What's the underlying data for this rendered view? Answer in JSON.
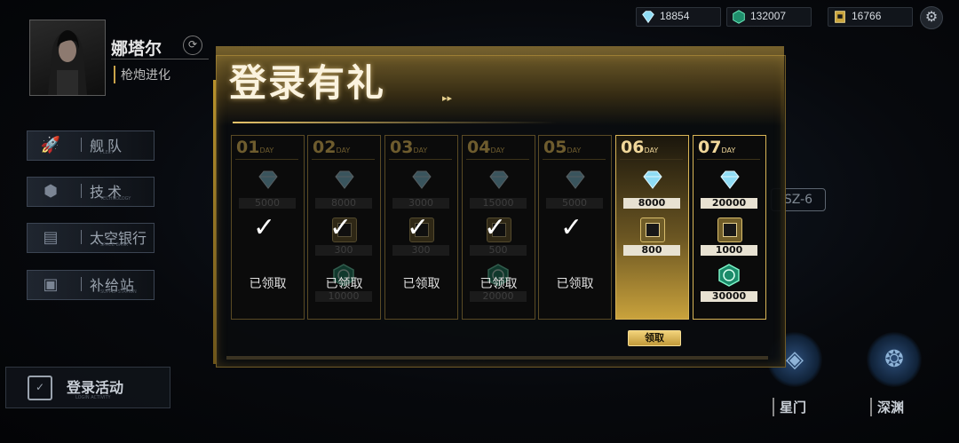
{
  "resources": [
    {
      "icon": "diamond-icon",
      "value": "18854"
    },
    {
      "icon": "energy-core-icon",
      "value": "132007"
    },
    {
      "icon": "chip-card-icon",
      "value": "16766"
    }
  ],
  "profile": {
    "name": "娜塔尔",
    "subtitle": "枪炮进化"
  },
  "menu": [
    {
      "label": "舰队",
      "sub": "FLEET"
    },
    {
      "label": "技术",
      "sub": "TECHNOLOGY"
    },
    {
      "label": "太空银行",
      "sub": "SPACE BANK"
    },
    {
      "label": "补给站",
      "sub": "SUPPLY STATION"
    }
  ],
  "login_activity": {
    "label": "登录活动",
    "sub": "LOGIN ACTIVITY"
  },
  "right_nav": {
    "stargate": "星门",
    "abyss": "深渊",
    "stage": "SZ-6"
  },
  "modal": {
    "title": "登录有礼",
    "day_suffix": "DAY",
    "claimed_text": "已领取",
    "claim_button": "领取",
    "days": [
      {
        "num": "01",
        "diamonds": "5000",
        "chips": "",
        "cores": "",
        "status": "claimed"
      },
      {
        "num": "02",
        "diamonds": "8000",
        "chips": "300",
        "cores": "10000",
        "status": "claimed"
      },
      {
        "num": "03",
        "diamonds": "3000",
        "chips": "300",
        "cores": "",
        "status": "claimed"
      },
      {
        "num": "04",
        "diamonds": "15000",
        "chips": "500",
        "cores": "20000",
        "status": "claimed"
      },
      {
        "num": "05",
        "diamonds": "5000",
        "chips": "",
        "cores": "",
        "status": "claimed"
      },
      {
        "num": "06",
        "diamonds": "8000",
        "chips": "800",
        "cores": "",
        "status": "available"
      },
      {
        "num": "07",
        "diamonds": "20000",
        "chips": "1000",
        "cores": "30000",
        "status": "locked"
      }
    ]
  },
  "colors": {
    "gold": "#d9b556",
    "diamond": "#7fd3f0",
    "core": "#3fc79a"
  }
}
